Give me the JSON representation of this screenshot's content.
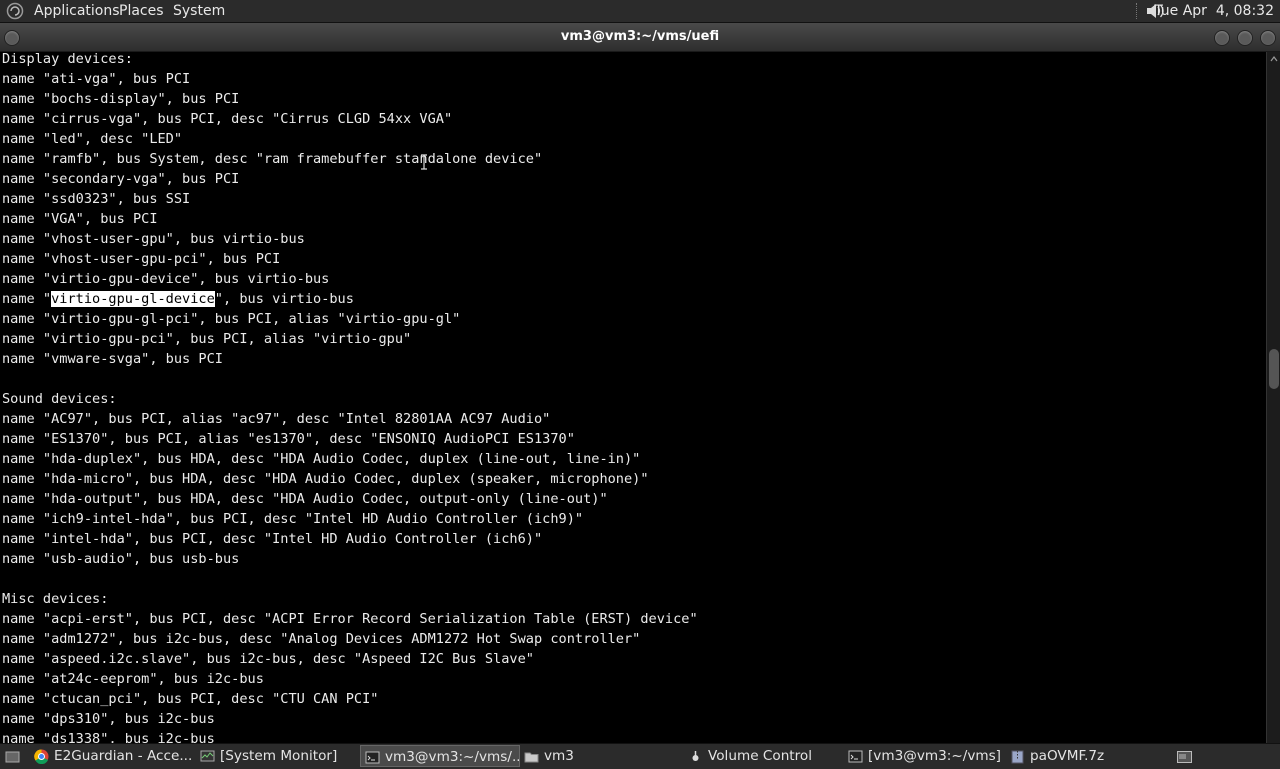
{
  "top_panel": {
    "menus": [
      "Applications",
      "Places",
      "System"
    ],
    "clock": "Tue Apr  4, 08:32"
  },
  "window": {
    "title": "vm3@vm3:~/vms/uefi"
  },
  "terminal": {
    "lines": [
      "Display devices:",
      "name \"ati-vga\", bus PCI",
      "name \"bochs-display\", bus PCI",
      "name \"cirrus-vga\", bus PCI, desc \"Cirrus CLGD 54xx VGA\"",
      "name \"led\", desc \"LED\"",
      "name \"ramfb\", bus System, desc \"ram framebuffer standalone device\"",
      "name \"secondary-vga\", bus PCI",
      "name \"ssd0323\", bus SSI",
      "name \"VGA\", bus PCI",
      "name \"vhost-user-gpu\", bus virtio-bus",
      "name \"vhost-user-gpu-pci\", bus PCI",
      "name \"virtio-gpu-device\", bus virtio-bus",
      {
        "before": "name \"",
        "highlight": "virtio-gpu-gl-device",
        "after": "\", bus virtio-bus"
      },
      "name \"virtio-gpu-gl-pci\", bus PCI, alias \"virtio-gpu-gl\"",
      "name \"virtio-gpu-pci\", bus PCI, alias \"virtio-gpu\"",
      "name \"vmware-svga\", bus PCI",
      "",
      "Sound devices:",
      "name \"AC97\", bus PCI, alias \"ac97\", desc \"Intel 82801AA AC97 Audio\"",
      "name \"ES1370\", bus PCI, alias \"es1370\", desc \"ENSONIQ AudioPCI ES1370\"",
      "name \"hda-duplex\", bus HDA, desc \"HDA Audio Codec, duplex (line-out, line-in)\"",
      "name \"hda-micro\", bus HDA, desc \"HDA Audio Codec, duplex (speaker, microphone)\"",
      "name \"hda-output\", bus HDA, desc \"HDA Audio Codec, output-only (line-out)\"",
      "name \"ich9-intel-hda\", bus PCI, desc \"Intel HD Audio Controller (ich9)\"",
      "name \"intel-hda\", bus PCI, desc \"Intel HD Audio Controller (ich6)\"",
      "name \"usb-audio\", bus usb-bus",
      "",
      "Misc devices:",
      "name \"acpi-erst\", bus PCI, desc \"ACPI Error Record Serialization Table (ERST) device\"",
      "name \"adm1272\", bus i2c-bus, desc \"Analog Devices ADM1272 Hot Swap controller\"",
      "name \"aspeed.i2c.slave\", bus i2c-bus, desc \"Aspeed I2C Bus Slave\"",
      "name \"at24c-eeprom\", bus i2c-bus",
      "name \"ctucan_pci\", bus PCI, desc \"CTU CAN PCI\"",
      "name \"dps310\", bus i2c-bus",
      "name \"ds1338\", bus i2c-bus"
    ]
  },
  "taskbar": {
    "items": [
      {
        "label": "E2Guardian - Acce...",
        "icon": "chrome-icon",
        "active": false
      },
      {
        "label": "[System Monitor]",
        "icon": "system-monitor-icon",
        "active": false
      },
      {
        "label": "vm3@vm3:~/vms/...",
        "icon": "terminal-icon",
        "active": true
      },
      {
        "label": "vm3",
        "icon": "folder-icon",
        "active": false
      },
      {
        "label": "Volume Control",
        "icon": "volume-control-icon",
        "active": false
      },
      {
        "label": "[vm3@vm3:~/vms]",
        "icon": "terminal-icon",
        "active": false
      },
      {
        "label": "paOVMF.7z",
        "icon": "archive-icon",
        "active": false
      }
    ]
  },
  "colors": {
    "panel_bg": "#2b2b2b",
    "terminal_bg": "#000000",
    "terminal_fg": "#ececec",
    "selection_bg": "#ffffff"
  }
}
